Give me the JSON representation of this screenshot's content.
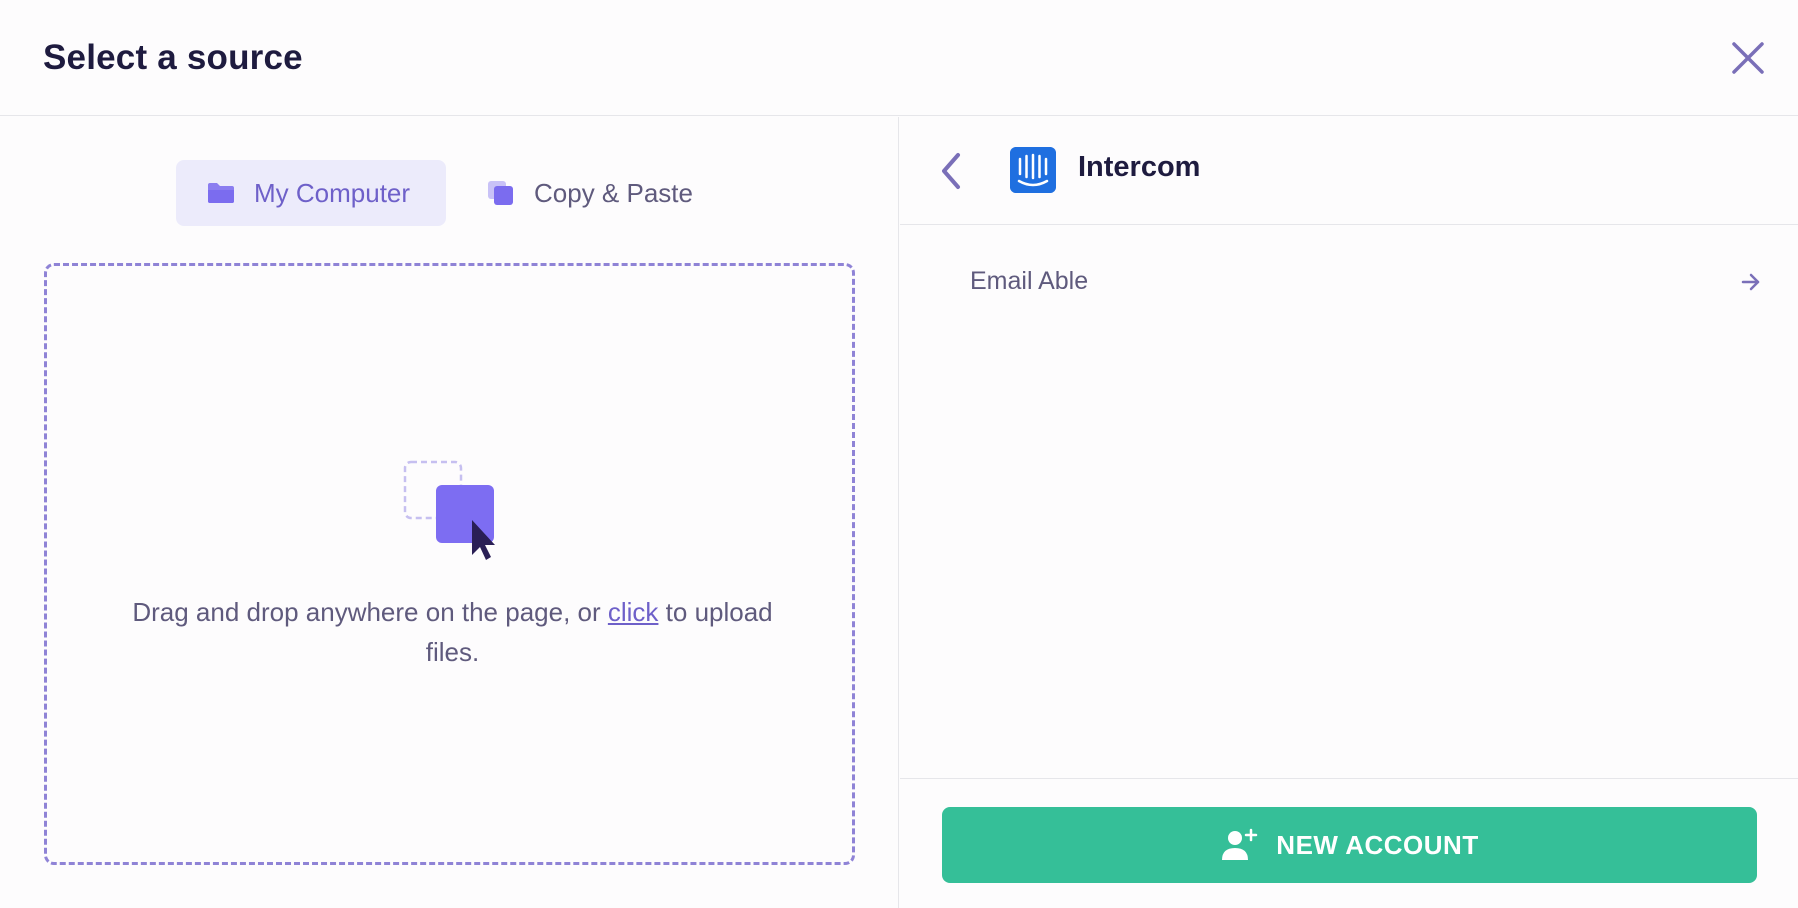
{
  "header": {
    "title": "Select a source"
  },
  "tabs": [
    {
      "label": "My Computer",
      "active": true
    },
    {
      "label": "Copy & Paste",
      "active": false
    }
  ],
  "dropzone": {
    "text_before": "Drag and drop anywhere on the page, or ",
    "link_label": "click",
    "text_after": " to upload files."
  },
  "source_panel": {
    "provider_name": "Intercom",
    "accounts": [
      {
        "name": "Email Able"
      }
    ],
    "new_account_label": "NEW ACCOUNT"
  },
  "colors": {
    "accent": "#6e60c9",
    "tab_active_bg": "#ecebfb",
    "primary_button": "#35bf98",
    "intercom_blue": "#1f6fe0",
    "title_text": "#1e1b3f"
  },
  "icons": {
    "close": "close-icon",
    "folder": "folder-icon",
    "copy": "copy-icon",
    "drop": "drag-drop-icon",
    "back": "chevron-left-icon",
    "logo": "intercom-logo-icon",
    "arrow": "arrow-right-icon",
    "add_user": "add-user-icon"
  }
}
